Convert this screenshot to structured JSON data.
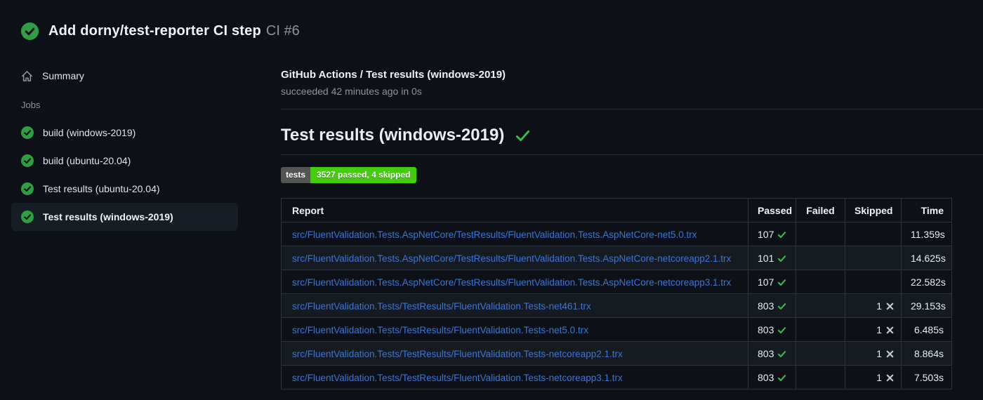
{
  "header": {
    "title": "Add dorny/test-reporter CI step",
    "run_number": "CI #6",
    "status_icon": "check-circle-icon"
  },
  "sidebar": {
    "summary_label": "Summary",
    "summary_icon": "home-icon",
    "jobs_label": "Jobs",
    "jobs": [
      {
        "label": "build (windows-2019)",
        "status": "success",
        "selected": false
      },
      {
        "label": "build (ubuntu-20.04)",
        "status": "success",
        "selected": false
      },
      {
        "label": "Test results (ubuntu-20.04)",
        "status": "success",
        "selected": false
      },
      {
        "label": "Test results (windows-2019)",
        "status": "success",
        "selected": true
      }
    ]
  },
  "main": {
    "check_title": "GitHub Actions / Test results (windows-2019)",
    "check_subtitle": "succeeded 42 minutes ago in 0s",
    "section_title": "Test results (windows-2019)",
    "section_status_icon": "check-icon",
    "badge": {
      "label": "tests",
      "value": "3527 passed, 4 skipped"
    },
    "table": {
      "headers": [
        "Report",
        "Passed",
        "Failed",
        "Skipped",
        "Time"
      ],
      "rows": [
        {
          "report": "src/FluentValidation.Tests.AspNetCore/TestResults/FluentValidation.Tests.AspNetCore-net5.0.trx",
          "passed": "107",
          "failed": "",
          "skipped": "",
          "time": "11.359s"
        },
        {
          "report": "src/FluentValidation.Tests.AspNetCore/TestResults/FluentValidation.Tests.AspNetCore-netcoreapp2.1.trx",
          "passed": "101",
          "failed": "",
          "skipped": "",
          "time": "14.625s"
        },
        {
          "report": "src/FluentValidation.Tests.AspNetCore/TestResults/FluentValidation.Tests.AspNetCore-netcoreapp3.1.trx",
          "passed": "107",
          "failed": "",
          "skipped": "",
          "time": "22.582s"
        },
        {
          "report": "src/FluentValidation.Tests/TestResults/FluentValidation.Tests-net461.trx",
          "passed": "803",
          "failed": "",
          "skipped": "1",
          "time": "29.153s"
        },
        {
          "report": "src/FluentValidation.Tests/TestResults/FluentValidation.Tests-net5.0.trx",
          "passed": "803",
          "failed": "",
          "skipped": "1",
          "time": "6.485s"
        },
        {
          "report": "src/FluentValidation.Tests/TestResults/FluentValidation.Tests-netcoreapp2.1.trx",
          "passed": "803",
          "failed": "",
          "skipped": "1",
          "time": "8.864s"
        },
        {
          "report": "src/FluentValidation.Tests/TestResults/FluentValidation.Tests-netcoreapp3.1.trx",
          "passed": "803",
          "failed": "",
          "skipped": "1",
          "time": "7.503s"
        }
      ]
    }
  },
  "colors": {
    "background": "#0d1117",
    "status_green": "#2ea043",
    "check_green": "#3fb950",
    "link_blue": "#3b76d4",
    "badge_label_bg": "#555555",
    "badge_value_bg": "#44cc11",
    "muted_text": "#8b949e",
    "row_alt_bg": "#161b22",
    "border": "#2d343d"
  }
}
